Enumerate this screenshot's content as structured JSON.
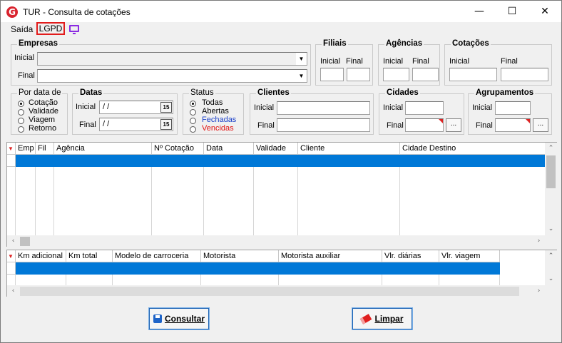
{
  "window": {
    "title": "TUR - Consulta de cotações",
    "logo_letter": "G",
    "minimize": "—",
    "maximize": "☐",
    "close": "✕"
  },
  "menu": {
    "saida": "Saída",
    "lgpd": "LGPD"
  },
  "empresas": {
    "legend": "Empresas",
    "inicial_label": "Inicial",
    "final_label": "Final",
    "inicial_value": "",
    "final_value": ""
  },
  "filiais": {
    "legend": "Filiais",
    "inicial_label": "Inicial",
    "final_label": "Final"
  },
  "agencias": {
    "legend": "Agências",
    "inicial_label": "Inicial",
    "final_label": "Final"
  },
  "cotacoes": {
    "legend": "Cotações",
    "inicial_label": "Inicial",
    "final_label": "Final"
  },
  "por_data": {
    "legend": "Por data de",
    "options": [
      "Cotação",
      "Validade",
      "Viagem",
      "Retorno"
    ],
    "selected": "Cotação"
  },
  "datas": {
    "legend": "Datas",
    "inicial_label": "Inicial",
    "final_label": "Final",
    "inicial_value": " /  /",
    "final_value": " /  /",
    "calendar_glyph": "15"
  },
  "status": {
    "legend": "Status",
    "options": [
      "Todas",
      "Abertas",
      "Fechadas",
      "Vencidas"
    ],
    "selected": "Todas",
    "colors": {
      "Todas": "#000000",
      "Abertas": "#000000",
      "Fechadas": "#1a3fc8",
      "Vencidas": "#e01010"
    }
  },
  "clientes": {
    "legend": "Clientes",
    "inicial_label": "Inicial",
    "final_label": "Final"
  },
  "cidades": {
    "legend": "Cidades",
    "inicial_label": "Inicial",
    "final_label": "Final",
    "dots": "..."
  },
  "agrupamentos": {
    "legend": "Agrupamentos",
    "inicial_label": "Inicial",
    "final_label": "Final",
    "dots": "..."
  },
  "grid_main": {
    "columns": [
      "Emp",
      "Fil",
      "Agência",
      "Nº Cotação",
      "Data",
      "Validade",
      "Cliente",
      "Cidade Destino"
    ]
  },
  "grid_detail": {
    "columns": [
      "Km adicional",
      "Km total",
      "Modelo de carroceria",
      "Motorista",
      "Motorista auxiliar",
      "Vlr. diárias",
      "Vlr. viagem"
    ]
  },
  "buttons": {
    "consultar": "Consultar",
    "limpar": "Limpar"
  },
  "colors": {
    "selection": "#0078d7",
    "accent_red": "#e21c1c",
    "monitor_icon": "#8b2be2"
  }
}
